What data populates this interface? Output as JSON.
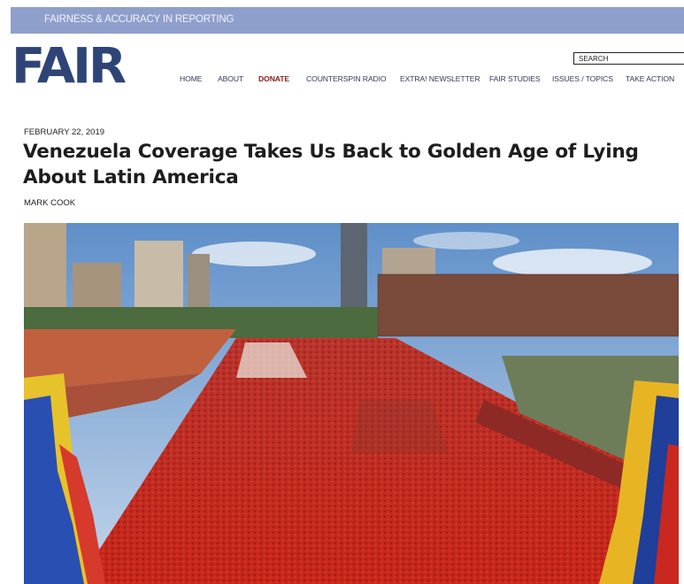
{
  "topbar": {
    "text": "FAIRNESS & ACCURACY IN REPORTING"
  },
  "logo": {
    "text": "FAIR",
    "color": "#2f4476"
  },
  "search": {
    "placeholder": "SEARCH"
  },
  "nav": {
    "items": [
      {
        "label": "HOME"
      },
      {
        "label": "ABOUT"
      },
      {
        "label": "DONATE"
      },
      {
        "label": "COUNTERSPIN RADIO"
      },
      {
        "label": "EXTRA! NEWSLETTER"
      },
      {
        "label": "FAIR STUDIES"
      },
      {
        "label": "ISSUES / TOPICS"
      },
      {
        "label": "TAKE ACTION"
      }
    ]
  },
  "article": {
    "date": "FEBRUARY 22, 2019",
    "title": "Venezuela Coverage Takes Us Back to Golden Age of Lying About Latin America",
    "author": "MARK COOK"
  },
  "colors": {
    "topbar": "#8f9fcc",
    "nav_text": "#333a55",
    "donate": "#8b1c1c",
    "crowd_red": "#c8241c"
  }
}
